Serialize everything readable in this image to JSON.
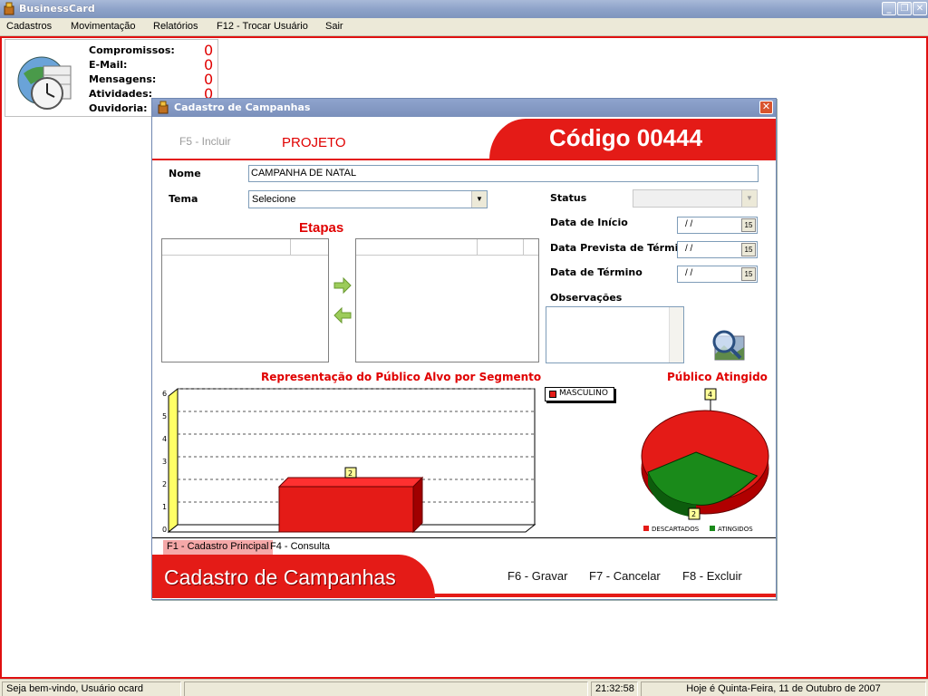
{
  "app": {
    "title": "BusinessCard"
  },
  "window_controls": {
    "minimize": "_",
    "restore": "❐",
    "close": "✕"
  },
  "menu": {
    "items": [
      {
        "label": "Cadastros"
      },
      {
        "label": "Movimentação"
      },
      {
        "label": "Relatórios"
      },
      {
        "label": "F12 - Trocar Usuário"
      },
      {
        "label": "Sair"
      }
    ]
  },
  "info_panel": {
    "rows": [
      {
        "label": "Compromissos:",
        "value": "0"
      },
      {
        "label": "E-Mail:",
        "value": "0"
      },
      {
        "label": "Mensagens:",
        "value": "0"
      },
      {
        "label": "Atividades:",
        "value": "0"
      },
      {
        "label": "Ouvidoria:",
        "value": ""
      }
    ]
  },
  "dialog": {
    "title": "Cadastro de Campanhas",
    "close": "✕",
    "f5_label": "F5 - Incluir",
    "mode_label": "PROJETO",
    "codigo": "Código 00444",
    "nome_label": "Nome",
    "nome_value": "CAMPANHA DE NATAL",
    "tema_label": "Tema",
    "tema_value": "Selecione",
    "status_label": "Status",
    "status_value": "",
    "data_inicio_label": "Data de Início",
    "data_inicio_value": "/ /",
    "data_prevista_label": "Data Prevista de Término",
    "data_prevista_value": "/ /",
    "data_termino_label": "Data de Término",
    "data_termino_value": "/ /",
    "calendar_label": "15",
    "observacoes_label": "Observações",
    "etapas_label": "Etapas",
    "tabs": [
      {
        "label": "F1 - Cadastro Principal"
      },
      {
        "label": "F4 - Consulta"
      }
    ],
    "footer_title": "Cadastro de Campanhas",
    "buttons": {
      "gravar": "F6 - Gravar",
      "cancelar": "F7 - Cancelar",
      "excluir": "F8 - Excluir"
    }
  },
  "chart_data": [
    {
      "type": "bar",
      "title": "Representação do Público Alvo por Segmento",
      "categories": [
        ""
      ],
      "series": [
        {
          "name": "MASCULINO",
          "values": [
            2
          ]
        }
      ],
      "ylim": [
        0,
        6
      ],
      "yticks": [
        "0",
        "1",
        "2",
        "3",
        "4",
        "5",
        "6"
      ],
      "data_labels": [
        "2"
      ],
      "grid": true,
      "legend_position": "right",
      "color": "#e41b17"
    },
    {
      "type": "pie",
      "title": "Público Atingido",
      "labels": [
        "DESCARTADOS",
        "ATINGIDOS"
      ],
      "values": [
        4,
        2
      ],
      "data_labels": [
        "4",
        "2"
      ],
      "colors": [
        "#e41b17",
        "#1a8a1a"
      ],
      "legend_position": "bottom"
    }
  ],
  "statusbar": {
    "welcome": "Seja bem-vindo, Usuário ocard",
    "blank": "",
    "time": "21:32:58",
    "date": "Hoje é Quinta-Feira, 11 de Outubro de 2007"
  },
  "icons": {
    "app": "business-card-icon",
    "info_panel": "calendar-clock-globe-icon",
    "move_right": "arrow-right-icon",
    "move_left": "arrow-left-icon",
    "search": "magnifier-icon"
  }
}
